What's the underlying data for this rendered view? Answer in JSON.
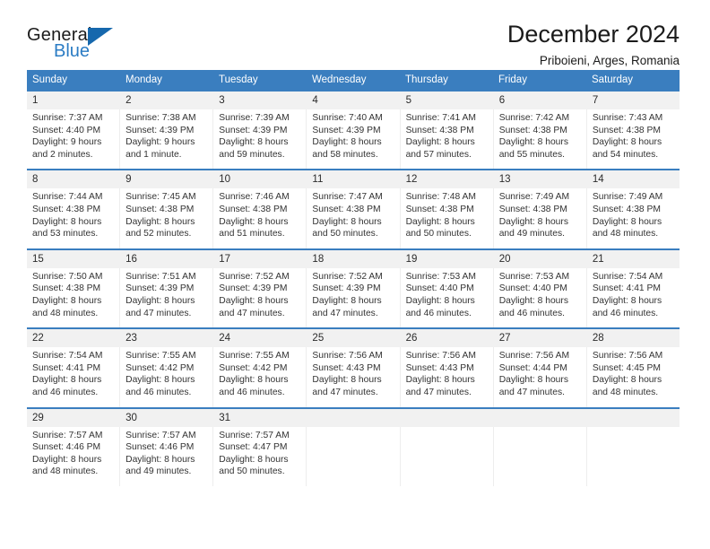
{
  "brand": {
    "name_part1": "General",
    "name_part2": "Blue",
    "triangle_icon": "triangle-icon",
    "colors": {
      "dark": "#1b1b1b",
      "blue": "#2b7cc4",
      "triangle": "#1668ad"
    }
  },
  "header": {
    "title": "December 2024",
    "subtitle": "Priboieni, Arges, Romania"
  },
  "theme": {
    "header_blue": "#3a7ebf",
    "daynum_band": "#f1f1f1",
    "text": "#333333"
  },
  "calendar": {
    "weekdays": [
      "Sunday",
      "Monday",
      "Tuesday",
      "Wednesday",
      "Thursday",
      "Friday",
      "Saturday"
    ],
    "weeks": [
      [
        {
          "day": "1",
          "sunrise": "Sunrise: 7:37 AM",
          "sunset": "Sunset: 4:40 PM",
          "daylight_line1": "Daylight: 9 hours",
          "daylight_line2": "and 2 minutes."
        },
        {
          "day": "2",
          "sunrise": "Sunrise: 7:38 AM",
          "sunset": "Sunset: 4:39 PM",
          "daylight_line1": "Daylight: 9 hours",
          "daylight_line2": "and 1 minute."
        },
        {
          "day": "3",
          "sunrise": "Sunrise: 7:39 AM",
          "sunset": "Sunset: 4:39 PM",
          "daylight_line1": "Daylight: 8 hours",
          "daylight_line2": "and 59 minutes."
        },
        {
          "day": "4",
          "sunrise": "Sunrise: 7:40 AM",
          "sunset": "Sunset: 4:39 PM",
          "daylight_line1": "Daylight: 8 hours",
          "daylight_line2": "and 58 minutes."
        },
        {
          "day": "5",
          "sunrise": "Sunrise: 7:41 AM",
          "sunset": "Sunset: 4:38 PM",
          "daylight_line1": "Daylight: 8 hours",
          "daylight_line2": "and 57 minutes."
        },
        {
          "day": "6",
          "sunrise": "Sunrise: 7:42 AM",
          "sunset": "Sunset: 4:38 PM",
          "daylight_line1": "Daylight: 8 hours",
          "daylight_line2": "and 55 minutes."
        },
        {
          "day": "7",
          "sunrise": "Sunrise: 7:43 AM",
          "sunset": "Sunset: 4:38 PM",
          "daylight_line1": "Daylight: 8 hours",
          "daylight_line2": "and 54 minutes."
        }
      ],
      [
        {
          "day": "8",
          "sunrise": "Sunrise: 7:44 AM",
          "sunset": "Sunset: 4:38 PM",
          "daylight_line1": "Daylight: 8 hours",
          "daylight_line2": "and 53 minutes."
        },
        {
          "day": "9",
          "sunrise": "Sunrise: 7:45 AM",
          "sunset": "Sunset: 4:38 PM",
          "daylight_line1": "Daylight: 8 hours",
          "daylight_line2": "and 52 minutes."
        },
        {
          "day": "10",
          "sunrise": "Sunrise: 7:46 AM",
          "sunset": "Sunset: 4:38 PM",
          "daylight_line1": "Daylight: 8 hours",
          "daylight_line2": "and 51 minutes."
        },
        {
          "day": "11",
          "sunrise": "Sunrise: 7:47 AM",
          "sunset": "Sunset: 4:38 PM",
          "daylight_line1": "Daylight: 8 hours",
          "daylight_line2": "and 50 minutes."
        },
        {
          "day": "12",
          "sunrise": "Sunrise: 7:48 AM",
          "sunset": "Sunset: 4:38 PM",
          "daylight_line1": "Daylight: 8 hours",
          "daylight_line2": "and 50 minutes."
        },
        {
          "day": "13",
          "sunrise": "Sunrise: 7:49 AM",
          "sunset": "Sunset: 4:38 PM",
          "daylight_line1": "Daylight: 8 hours",
          "daylight_line2": "and 49 minutes."
        },
        {
          "day": "14",
          "sunrise": "Sunrise: 7:49 AM",
          "sunset": "Sunset: 4:38 PM",
          "daylight_line1": "Daylight: 8 hours",
          "daylight_line2": "and 48 minutes."
        }
      ],
      [
        {
          "day": "15",
          "sunrise": "Sunrise: 7:50 AM",
          "sunset": "Sunset: 4:38 PM",
          "daylight_line1": "Daylight: 8 hours",
          "daylight_line2": "and 48 minutes."
        },
        {
          "day": "16",
          "sunrise": "Sunrise: 7:51 AM",
          "sunset": "Sunset: 4:39 PM",
          "daylight_line1": "Daylight: 8 hours",
          "daylight_line2": "and 47 minutes."
        },
        {
          "day": "17",
          "sunrise": "Sunrise: 7:52 AM",
          "sunset": "Sunset: 4:39 PM",
          "daylight_line1": "Daylight: 8 hours",
          "daylight_line2": "and 47 minutes."
        },
        {
          "day": "18",
          "sunrise": "Sunrise: 7:52 AM",
          "sunset": "Sunset: 4:39 PM",
          "daylight_line1": "Daylight: 8 hours",
          "daylight_line2": "and 47 minutes."
        },
        {
          "day": "19",
          "sunrise": "Sunrise: 7:53 AM",
          "sunset": "Sunset: 4:40 PM",
          "daylight_line1": "Daylight: 8 hours",
          "daylight_line2": "and 46 minutes."
        },
        {
          "day": "20",
          "sunrise": "Sunrise: 7:53 AM",
          "sunset": "Sunset: 4:40 PM",
          "daylight_line1": "Daylight: 8 hours",
          "daylight_line2": "and 46 minutes."
        },
        {
          "day": "21",
          "sunrise": "Sunrise: 7:54 AM",
          "sunset": "Sunset: 4:41 PM",
          "daylight_line1": "Daylight: 8 hours",
          "daylight_line2": "and 46 minutes."
        }
      ],
      [
        {
          "day": "22",
          "sunrise": "Sunrise: 7:54 AM",
          "sunset": "Sunset: 4:41 PM",
          "daylight_line1": "Daylight: 8 hours",
          "daylight_line2": "and 46 minutes."
        },
        {
          "day": "23",
          "sunrise": "Sunrise: 7:55 AM",
          "sunset": "Sunset: 4:42 PM",
          "daylight_line1": "Daylight: 8 hours",
          "daylight_line2": "and 46 minutes."
        },
        {
          "day": "24",
          "sunrise": "Sunrise: 7:55 AM",
          "sunset": "Sunset: 4:42 PM",
          "daylight_line1": "Daylight: 8 hours",
          "daylight_line2": "and 46 minutes."
        },
        {
          "day": "25",
          "sunrise": "Sunrise: 7:56 AM",
          "sunset": "Sunset: 4:43 PM",
          "daylight_line1": "Daylight: 8 hours",
          "daylight_line2": "and 47 minutes."
        },
        {
          "day": "26",
          "sunrise": "Sunrise: 7:56 AM",
          "sunset": "Sunset: 4:43 PM",
          "daylight_line1": "Daylight: 8 hours",
          "daylight_line2": "and 47 minutes."
        },
        {
          "day": "27",
          "sunrise": "Sunrise: 7:56 AM",
          "sunset": "Sunset: 4:44 PM",
          "daylight_line1": "Daylight: 8 hours",
          "daylight_line2": "and 47 minutes."
        },
        {
          "day": "28",
          "sunrise": "Sunrise: 7:56 AM",
          "sunset": "Sunset: 4:45 PM",
          "daylight_line1": "Daylight: 8 hours",
          "daylight_line2": "and 48 minutes."
        }
      ],
      [
        {
          "day": "29",
          "sunrise": "Sunrise: 7:57 AM",
          "sunset": "Sunset: 4:46 PM",
          "daylight_line1": "Daylight: 8 hours",
          "daylight_line2": "and 48 minutes."
        },
        {
          "day": "30",
          "sunrise": "Sunrise: 7:57 AM",
          "sunset": "Sunset: 4:46 PM",
          "daylight_line1": "Daylight: 8 hours",
          "daylight_line2": "and 49 minutes."
        },
        {
          "day": "31",
          "sunrise": "Sunrise: 7:57 AM",
          "sunset": "Sunset: 4:47 PM",
          "daylight_line1": "Daylight: 8 hours",
          "daylight_line2": "and 50 minutes."
        },
        {
          "day": "",
          "sunrise": "",
          "sunset": "",
          "daylight_line1": "",
          "daylight_line2": ""
        },
        {
          "day": "",
          "sunrise": "",
          "sunset": "",
          "daylight_line1": "",
          "daylight_line2": ""
        },
        {
          "day": "",
          "sunrise": "",
          "sunset": "",
          "daylight_line1": "",
          "daylight_line2": ""
        },
        {
          "day": "",
          "sunrise": "",
          "sunset": "",
          "daylight_line1": "",
          "daylight_line2": ""
        }
      ]
    ]
  }
}
